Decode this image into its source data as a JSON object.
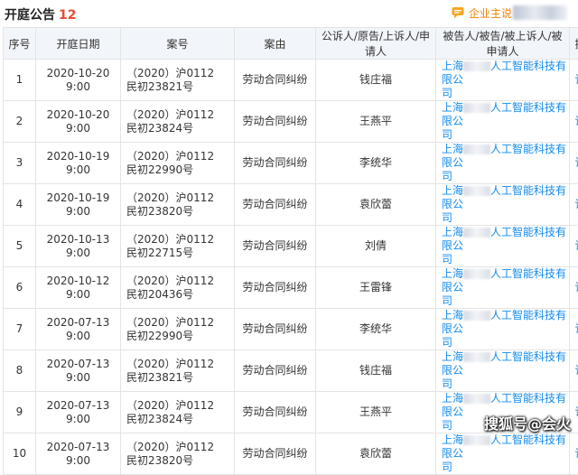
{
  "header": {
    "title": "开庭公告",
    "count": "12",
    "brand_label": "企业主说"
  },
  "table": {
    "columns": [
      "序号",
      "开庭日期",
      "案号",
      "案由",
      "公诉人/原告/上诉人/申请人",
      "被告人/被告/被上诉人/被申请人",
      "操作"
    ],
    "rows": [
      {
        "index": "1",
        "date": "2020-10-20 9:00",
        "case_no": [
          "（2020）沪0112",
          "民初23821号"
        ],
        "cause": "劳动合同纠纷",
        "plaintiff": "钱庄福",
        "def_prefix": "上海",
        "def_suffix": "人工智能科技有限公",
        "def_line2": "司",
        "op": "详情"
      },
      {
        "index": "2",
        "date": "2020-10-20 9:00",
        "case_no": [
          "（2020）沪0112",
          "民初23824号"
        ],
        "cause": "劳动合同纠纷",
        "plaintiff": "王燕平",
        "def_prefix": "上海",
        "def_suffix": "人工智能科技有限公",
        "def_line2": "司",
        "op": "详情"
      },
      {
        "index": "3",
        "date": "2020-10-19 9:00",
        "case_no": [
          "（2020）沪0112",
          "民初22990号"
        ],
        "cause": "劳动合同纠纷",
        "plaintiff": "李统华",
        "def_prefix": "上海",
        "def_suffix": "人工智能科技有限公",
        "def_line2": "司",
        "op": "详情"
      },
      {
        "index": "4",
        "date": "2020-10-19 9:00",
        "case_no": [
          "（2020）沪0112",
          "民初23820号"
        ],
        "cause": "劳动合同纠纷",
        "plaintiff": "袁欣蕾",
        "def_prefix": "上海",
        "def_suffix": "人工智能科技有限公",
        "def_line2": "司",
        "op": "详情"
      },
      {
        "index": "5",
        "date": "2020-10-13 9:00",
        "case_no": [
          "（2020）沪0112",
          "民初22715号"
        ],
        "cause": "劳动合同纠纷",
        "plaintiff": "刘倩",
        "def_prefix": "上海",
        "def_suffix": "人工智能科技有限公",
        "def_line2": "司",
        "op": "详情"
      },
      {
        "index": "6",
        "date": "2020-10-12 9:00",
        "case_no": [
          "（2020）沪0112",
          "民初20436号"
        ],
        "cause": "劳动合同纠纷",
        "plaintiff": "王雷锋",
        "def_prefix": "上海",
        "def_suffix": "人工智能科技有限公",
        "def_line2": "司",
        "op": "详情"
      },
      {
        "index": "7",
        "date": "2020-07-13 9:00",
        "case_no": [
          "（2020）沪0112",
          "民初22990号"
        ],
        "cause": "劳动合同纠纷",
        "plaintiff": "李统华",
        "def_prefix": "上海",
        "def_suffix": "人工智能科技有限公",
        "def_line2": "司",
        "op": "详情"
      },
      {
        "index": "8",
        "date": "2020-07-13 9:00",
        "case_no": [
          "（2020）沪0112",
          "民初23821号"
        ],
        "cause": "劳动合同纠纷",
        "plaintiff": "钱庄福",
        "def_prefix": "上海",
        "def_suffix": "人工智能科技有限公",
        "def_line2": "司",
        "op": "详情"
      },
      {
        "index": "9",
        "date": "2020-07-13 9:00",
        "case_no": [
          "（2020）沪0112",
          "民初23824号"
        ],
        "cause": "劳动合同纠纷",
        "plaintiff": "王燕平",
        "def_prefix": "上海",
        "def_suffix": "人工智能科技有限公",
        "def_line2": "司",
        "op": "详情"
      },
      {
        "index": "10",
        "date": "2020-07-13 9:00",
        "case_no": [
          "（2020）沪0112",
          "民初23820号"
        ],
        "cause": "劳动合同纠纷",
        "plaintiff": "袁欣蕾",
        "def_prefix": "上海",
        "def_suffix": "人工智能科技有限公",
        "def_line2": "司",
        "op": "详情"
      }
    ]
  },
  "watermark": "搜狐号@会火",
  "colors": {
    "accent_red": "#e8492d",
    "link_blue": "#128bed",
    "brand_orange": "#f08200",
    "header_bg": "#f2f5fa",
    "border": "#e4e4e4"
  },
  "icons": {
    "brand": "speech-bubble-icon"
  }
}
